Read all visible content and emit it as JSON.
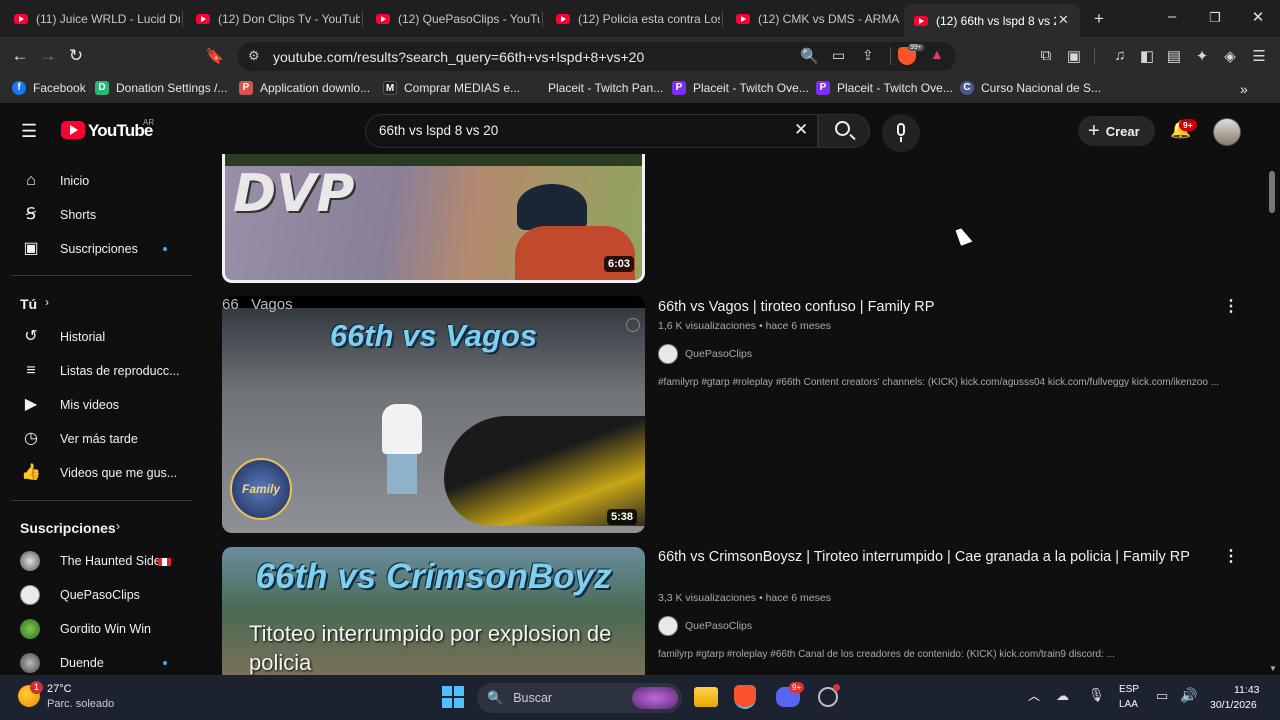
{
  "tabs": [
    {
      "label": "(11) Juice WRLD - Lucid Dr"
    },
    {
      "label": "(12) Don Clips Tv - YouTub"
    },
    {
      "label": "(12) QuePasoClips - YouTu"
    },
    {
      "label": "(12) Policia esta contra Los"
    },
    {
      "label": "(12) CMK vs DMS - ARMAS"
    },
    {
      "label": "(12) 66th vs lspd 8 vs 2"
    }
  ],
  "toolbar": {
    "url": "youtube.com/results?search_query=66th+vs+lspd+8+vs+20",
    "shield_badge": "99+"
  },
  "bookmarks": [
    {
      "label": "Facebook",
      "icon": "facebook-icon",
      "color": "#1877f2",
      "glyph": "f"
    },
    {
      "label": "Donation Settings /...",
      "icon": "donation-icon",
      "color": "#2bb673",
      "glyph": "D"
    },
    {
      "label": "Application downlo...",
      "icon": "pag-icon",
      "color": "#d9534f",
      "glyph": "P"
    },
    {
      "label": "Comprar MEDIAS e...",
      "icon": "medias-icon",
      "color": "#222222",
      "glyph": "M"
    },
    {
      "label": "Placeit - Twitch Pan...",
      "icon": "placeit-icon",
      "color": "#2b2b2b",
      "glyph": ""
    },
    {
      "label": "Placeit - Twitch Ove...",
      "icon": "placeit-p-icon",
      "color": "#7b2ff7",
      "glyph": "P"
    },
    {
      "label": "Placeit - Twitch Ove...",
      "icon": "placeit-p-icon",
      "color": "#7b2ff7",
      "glyph": "P"
    },
    {
      "label": "Curso Nacional de S...",
      "icon": "curso-icon",
      "color": "#4a5a8a",
      "glyph": "C"
    }
  ],
  "yt": {
    "logo_text": "YouTube",
    "region": "AR",
    "search_value": "66th vs lspd 8 vs 20",
    "create_label": "Crear",
    "notif_badge": "9+"
  },
  "sidebar": {
    "main": [
      {
        "label": "Inicio",
        "icon": "home-icon"
      },
      {
        "label": "Shorts",
        "icon": "shorts-icon"
      },
      {
        "label": "Suscripciones",
        "icon": "subscriptions-icon"
      }
    ],
    "you_header": "Tú",
    "you": [
      {
        "label": "Historial",
        "icon": "history-icon"
      },
      {
        "label": "Listas de reproducc...",
        "icon": "playlists-icon"
      },
      {
        "label": "Mis videos",
        "icon": "my-videos-icon"
      },
      {
        "label": "Ver más tarde",
        "icon": "watch-later-icon"
      },
      {
        "label": "Videos que me gus...",
        "icon": "like-icon"
      }
    ],
    "subs_header": "Suscripciones",
    "subs": [
      {
        "label": "The Haunted Side"
      },
      {
        "label": "QuePasoClips"
      },
      {
        "label": "Gordito Win Win"
      },
      {
        "label": "Duende"
      }
    ]
  },
  "results": [
    {
      "thumb_text": "DVP",
      "duration": "6:03"
    },
    {
      "thumb_text": "66th vs Vagos",
      "thumb_corner": "66   Vagos",
      "thumb_logo": "Family",
      "duration": "5:38",
      "title": "66th vs Vagos | tiroteo confuso | Family RP",
      "views": "1,6 K visualizaciones",
      "age": "hace 6 meses",
      "channel": "QuePasoClips",
      "desc": "#familyrp #gtarp #roleplay #66th Content creators' channels: (KICK) kick.com/agusss04 kick.com/fullveggy kick.com/ikenzoo ..."
    },
    {
      "thumb_text": "66th vs CrimsonBoyz",
      "thumb_sub": "Titoteo interrumpido por explosion de policia",
      "title": "66th vs CrimsonBoysz | Tiroteo interrumpido | Cae granada a la policia | Family RP",
      "views": "3,3 K visualizaciones",
      "age": "hace 6 meses",
      "channel": "QuePasoClips",
      "desc": "familyrp #gtarp #roleplay #66th Canal de los creadores de contenido: (KICK) kick.com/train9 discord: ..."
    }
  ],
  "taskbar": {
    "weather_temp": "27°C",
    "weather_desc": "Parc. soleado",
    "weather_badge": "1",
    "search_placeholder": "Buscar",
    "discord_badge": "9+",
    "lang_top": "ESP",
    "lang_bottom": "LAA",
    "time": "11:43",
    "date": "30/1/2026"
  },
  "colors": {
    "accent_red": "#ff0033",
    "link_blue": "#3ea6ff",
    "background": "#0f0f0f"
  }
}
